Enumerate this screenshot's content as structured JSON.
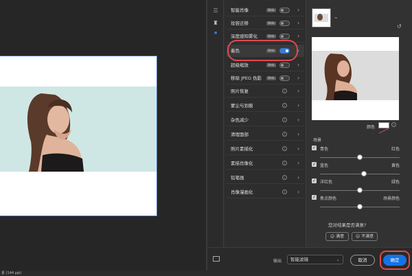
{
  "status_text": "素 (144 ppi)",
  "filters": [
    {
      "label": "智能肖像",
      "badge": "Beta",
      "toggle": "off"
    },
    {
      "label": "妆容迁移",
      "badge": "Beta",
      "toggle": "off"
    },
    {
      "label": "深度感知雾化",
      "badge": "Beta",
      "toggle": "off"
    },
    {
      "label": "着色",
      "badge": "Beta",
      "toggle": "on"
    },
    {
      "label": "超级缩放",
      "badge": "Beta",
      "toggle": "off"
    },
    {
      "label": "移除 JPEG 伪影",
      "badge": "Beta",
      "toggle": "off"
    },
    {
      "label": "照片恢复",
      "badge": "",
      "toggle": "info"
    },
    {
      "label": "蒙尘与划痕",
      "badge": "",
      "toggle": "info"
    },
    {
      "label": "杂色减少",
      "badge": "",
      "toggle": "info"
    },
    {
      "label": "清理面部",
      "badge": "",
      "toggle": "info"
    },
    {
      "label": "照片素描化",
      "badge": "",
      "toggle": "info"
    },
    {
      "label": "素描肖像化",
      "badge": "",
      "toggle": "info"
    },
    {
      "label": "铅笔画",
      "badge": "",
      "toggle": "info"
    },
    {
      "label": "肖像漫画化",
      "badge": "",
      "toggle": "info"
    }
  ],
  "color_label": "颜色",
  "scene_label": "场景",
  "sliders": [
    {
      "left": "青色",
      "right": "红色",
      "value": 0.5
    },
    {
      "left": "蓝色",
      "right": "黄色",
      "value": 0.55
    },
    {
      "left": "洋红色",
      "right": "绿色",
      "value": 0.5
    },
    {
      "left": "焦点颜色",
      "right": "场景颜色",
      "value": 0.5
    }
  ],
  "satisfaction": {
    "question": "您对结果是否满意?",
    "yes": "满意",
    "no": "不满意"
  },
  "footer": {
    "output_label": "输出",
    "output_value": "智能滤镜",
    "cancel": "取消",
    "ok": "确定"
  },
  "colors": {
    "accent": "#3a7bd5",
    "highlight": "#e04a4f"
  }
}
